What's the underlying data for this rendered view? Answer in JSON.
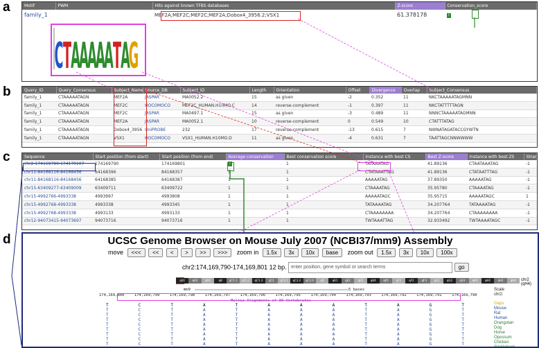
{
  "labels": {
    "a": "a",
    "b": "b",
    "c": "c",
    "d": "d"
  },
  "panel_a": {
    "headers": [
      "Motif",
      "PWM",
      "Hits against known TFBS databases",
      "Z-score",
      "Conservation_score"
    ],
    "row": {
      "motif": "family_1",
      "hits": "MEF2A;MEF2C;MEF2C;MEF2A;Dobox4_3956.2;VSX1",
      "zscore": "61.378178",
      "cons_icon": "i"
    },
    "logo_letters": [
      "C",
      "T",
      "A",
      "A",
      "A",
      "A",
      "A",
      "T",
      "A",
      "G"
    ],
    "logo_colors": {
      "A": "#2e8b2e",
      "C": "#2255cc",
      "G": "#e0a000",
      "T": "#d22222"
    }
  },
  "panel_b": {
    "headers": [
      "Query_ID",
      "Query_Consensus",
      "Subject_Name",
      "Source_DB",
      "Subject_ID",
      "Length",
      "Orientation",
      "Offset",
      "Divergence",
      "Overlap",
      "Subject_Consensus"
    ],
    "rows": [
      [
        "family_1",
        "CTAAAAATAGN",
        "MEF2A",
        "JASPAR",
        "MA0052.2",
        "15",
        "as given",
        "-2",
        "0.352",
        "11",
        "NKCTAAAAATAGMNN"
      ],
      [
        "family_1",
        "CTAAAAATAGN",
        "MEF2C",
        "HOCOMOCO",
        "MEF2C_HUMAN.H10MO.C",
        "14",
        "reverse-complement",
        "-1",
        "0.397",
        "11",
        "NKCTATTTTTAGN"
      ],
      [
        "family_1",
        "CTAAAAATAGN",
        "MEF2C",
        "JASPAR",
        "MA0497.1",
        "15",
        "as given",
        "-3",
        "0.489",
        "11",
        "NNNCTAAAAATAGMNN"
      ],
      [
        "family_1",
        "CTAAAAATAGN",
        "MEF2A",
        "JASPAR",
        "MA0052.1",
        "10",
        "reverse-complement",
        "0",
        "0.549",
        "10",
        "CTATTTATAG"
      ],
      [
        "family_1",
        "CTAAAAATAGN",
        "Dobox4_3956.2",
        "UniPROBE",
        "232",
        "17",
        "reverse-complement",
        "-13",
        "0.615",
        "7",
        "NWNATAGATACCGYWTN"
      ],
      [
        "family_1",
        "CTAAAAATAGN",
        "VSX1",
        "HOCOMOCO",
        "VSX1_HUMAN.H10MO.D",
        "11",
        "as given",
        "-4",
        "0.631",
        "7",
        "TAATTAGCNNWWWW"
      ]
    ]
  },
  "panel_c": {
    "headers": [
      "Sequence",
      "Start position (from start)",
      "Start position (from end)",
      "Average conservation",
      "Best conservation score",
      "Instance with best CS",
      "Best Z-score",
      "Instance with best ZS",
      "Strand"
    ],
    "rows": [
      [
        "chr2-174169790-174170107",
        "174169790",
        "174169801",
        "i",
        "1",
        "TATAAATAG",
        "41.89136",
        "CTAATAAATAG",
        "-1"
      ],
      [
        "chr11-84168116-84168456",
        "64168396",
        "84168357",
        "1",
        "1",
        "CTATAAATTAG",
        "41.89136",
        "CTATAATTTAG",
        "-1"
      ],
      [
        "chr11-84168116-84168456",
        "64168385",
        "64168387",
        "1",
        "1",
        "AAAAATAG",
        "37.89350",
        "AAAAATAG",
        "-1"
      ],
      [
        "chr15-63409277-63409009",
        "63409711",
        "63409722",
        "1",
        "1",
        "CTAAAATAG",
        "35.95780",
        "CTAAAATAG",
        "-1"
      ],
      [
        "chr15-4992766-4993338",
        "4993997",
        "4993808",
        "1",
        "1",
        "AAAAATAGC",
        "35.95715",
        "AAAAATAGC",
        "1"
      ],
      [
        "chr15-4992768-4993338",
        "4993338",
        "4993345",
        "1",
        "1",
        "TATAAAATAG",
        "34.207764",
        "TATAAAATAG",
        "-1"
      ],
      [
        "chr15-4992768-4993338",
        "4993133",
        "4993133",
        "1",
        "1",
        "CTAAAAAAAA",
        "34.207764",
        "CTAAAAAAAA",
        "-1"
      ],
      [
        "chr12-94073415-94073697",
        "94073716",
        "94073716",
        "1",
        "1",
        "TWTAAATTAG",
        "32.933492",
        "TWTAAAATAGC",
        "-1"
      ]
    ]
  },
  "panel_d": {
    "title": "UCSC Genome Browser on Mouse July 2007 (NCBI37/mm9) Assembly",
    "move_label": "move",
    "move_buttons": [
      "<<<",
      "<<",
      "<",
      ">",
      ">>",
      ">>>"
    ],
    "zoom_in_label": "zoom in",
    "zoom_in_buttons": [
      "1.5x",
      "3x",
      "10x",
      "base"
    ],
    "zoom_out_label": "zoom out",
    "zoom_out_buttons": [
      "1.5x",
      "3x",
      "10x",
      "100x"
    ],
    "position": "chr2:174,169,790-174,169,801",
    "size": "12 bp.",
    "search_placeholder": "enter position, gene symbol or search terms",
    "go_label": "go",
    "ideogram_bands": [
      "qA1",
      "qA2",
      "qA3",
      "qB",
      "qC1.1",
      "qC1.2",
      "qC1.3",
      "qC2",
      "qC3.1",
      "qC3.2",
      "qC3.3",
      "qD",
      "qE1",
      "qE2",
      "qE3",
      "qE4",
      "qE5",
      "qF1",
      "qF2",
      "qF3",
      "qG1",
      "qG2",
      "qG3",
      "qH1",
      "qH2",
      "qH3",
      "qH4"
    ],
    "chrom_label": "chr2 (qH4)",
    "scale_label": "Scale",
    "chr_label": "chr2:",
    "tick_labels": [
      "174,169,800",
      "174,169,799",
      "174,169,798",
      "174,169,797",
      "174,169,796",
      "174,169,795",
      "174,169,794",
      "174,169,793",
      "174,169,792",
      "174,169,791",
      "174,169,790"
    ],
    "scale_bar": "5 bases",
    "assembly": "mm9",
    "multiz_label": "Multiz Alignments of 30 Vertebrates",
    "species": [
      "Mouse",
      "Rat",
      "Human",
      "Orangutan",
      "Dog",
      "Horse",
      "Opossum",
      "Chicken",
      "Stickleback"
    ],
    "species_header": "Gaps",
    "seq_columns": [
      "T",
      "C",
      "T",
      "A",
      "T",
      "A",
      "A",
      "A",
      "T",
      "A",
      "G",
      "T"
    ]
  }
}
